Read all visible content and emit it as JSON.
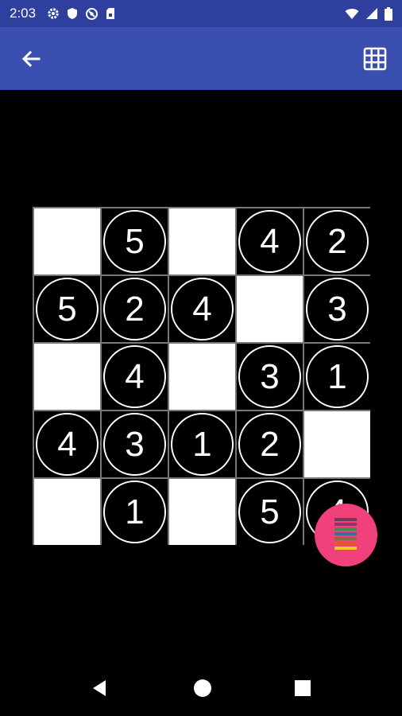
{
  "status_bar": {
    "time": "2:03",
    "left_icons": [
      "gear-icon",
      "shield-icon",
      "data-saver-icon",
      "sim-card-icon"
    ],
    "right_icons": [
      "wifi-icon",
      "signal-icon",
      "battery-icon"
    ]
  },
  "app_bar": {
    "back_icon": "arrow-left-icon",
    "action_icon": "grid-icon",
    "color": "#3a4fb0"
  },
  "board": {
    "size": 5,
    "cells": [
      [
        "",
        "5",
        "",
        "4",
        "2"
      ],
      [
        "5",
        "2",
        "4",
        "",
        "3"
      ],
      [
        "",
        "4",
        "",
        "3",
        "1"
      ],
      [
        "4",
        "3",
        "1",
        "2",
        ""
      ],
      [
        "",
        "1",
        "",
        "5",
        "4"
      ]
    ]
  },
  "fab": {
    "icon": "color-stack-icon",
    "color": "#f0417a"
  },
  "nav_bar": {
    "icons": [
      "nav-back-icon",
      "nav-home-icon",
      "nav-recents-icon"
    ]
  }
}
